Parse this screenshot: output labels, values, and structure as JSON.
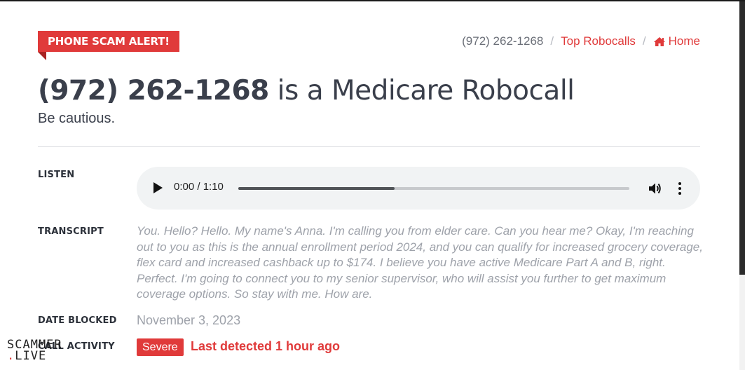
{
  "header": {
    "alert_tag": "PHONE SCAM ALERT!",
    "breadcrumb": {
      "current": "(972) 262-1268",
      "separator": "/",
      "top_robocalls": "Top Robocalls",
      "home": "Home"
    }
  },
  "title": {
    "number": "(972) 262-1268",
    "rest": " is a Medicare Robocall",
    "subtitle": "Be cautious."
  },
  "listen": {
    "label": "LISTEN",
    "time": "0:00 / 1:10",
    "progress_fraction": 0.4
  },
  "transcript": {
    "label": "TRANSCRIPT",
    "text": "You. Hello? Hello. My name's Anna. I'm calling you from elder care. Can you hear me? Okay, I'm reaching out to you as this is the annual enrollment period 2024, and you can qualify for increased grocery coverage, flex card and increased cashback up to $174. I believe you have active Medicare Part A and B, right. Perfect. I'm going to connect you to my senior supervisor, who will assist you further to get maximum coverage options. So stay with me. How are."
  },
  "date_blocked": {
    "label": "DATE BLOCKED",
    "value": "November 3, 2023"
  },
  "call_activity": {
    "label": "CALL ACTIVITY",
    "badge": "Severe",
    "detected": "Last detected 1 hour ago"
  },
  "watermark": {
    "line1": "SCAMMER",
    "line2_dot": ".",
    "line2": "LIVE"
  },
  "colors": {
    "accent": "#e03a3a",
    "text": "#3a3f4b",
    "muted": "#9ea2aa"
  },
  "icons": {
    "home": "home-icon",
    "play": "play-icon",
    "volume": "volume-icon",
    "menu": "more-vert-icon"
  }
}
